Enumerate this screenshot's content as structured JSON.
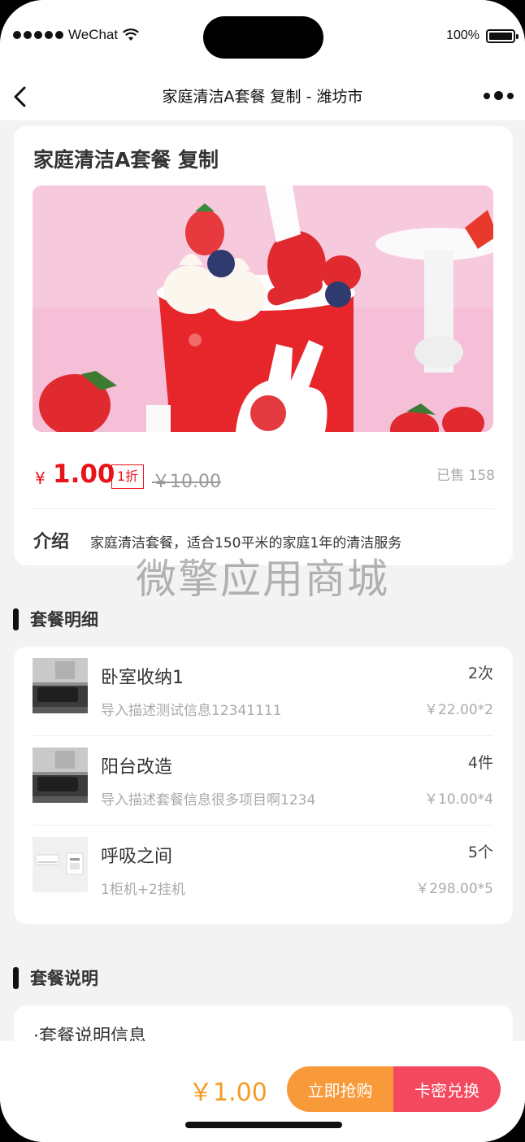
{
  "status_bar": {
    "carrier": "WeChat",
    "battery": "100%"
  },
  "nav": {
    "title": "家庭清洁A套餐 复制 - 潍坊市",
    "back_icon": "chevron-left-icon",
    "more_icon": "more-dots-icon"
  },
  "product": {
    "title": "家庭清洁A套餐 复制",
    "price_symbol": "¥",
    "price": "1.00",
    "discount": "1折",
    "original_price": "￥10.00",
    "sold": "已售 158",
    "intro_label": "介绍",
    "intro_text": "家庭清洁套餐，适合150平米的家庭1年的清洁服务"
  },
  "watermark": "微擎应用商城",
  "package_details": {
    "title": "套餐明细",
    "items": [
      {
        "name": "卧室收纳1",
        "qty": "2次",
        "desc": "导入描述测试信息12341111",
        "price": "￥22.00*2",
        "thumb": "living-room-photo"
      },
      {
        "name": "阳台改造",
        "qty": "4件",
        "desc": "导入描述套餐信息很多项目啊1234",
        "price": "￥10.00*4",
        "thumb": "living-room-photo"
      },
      {
        "name": "呼吸之间",
        "qty": "5个",
        "desc": "1柜机+2挂机",
        "price": "￥298.00*5",
        "thumb": "air-conditioner-photo"
      }
    ]
  },
  "package_description": {
    "title": "套餐说明",
    "info": "·套餐说明信息"
  },
  "bottom_bar": {
    "price": "￥1.00",
    "buy_label": "立即抢购",
    "card_label": "卡密兑换"
  },
  "colors": {
    "price_red": "#e8141a",
    "orange": "#f89a3a",
    "pink_red": "#f4485f",
    "background": "#f3f3f3"
  }
}
